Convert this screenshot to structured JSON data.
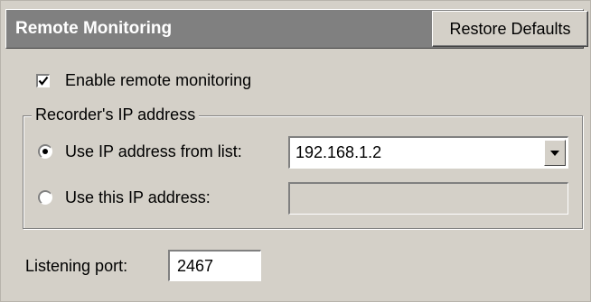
{
  "header": {
    "title": "Remote Monitoring",
    "restore_label": "Restore Defaults"
  },
  "enable_remote": {
    "label": "Enable remote monitoring",
    "checked": true
  },
  "ip_group": {
    "legend": "Recorder's IP address",
    "option_list": {
      "label": "Use IP address from list:",
      "selected": true,
      "value": "192.168.1.2"
    },
    "option_custom": {
      "label": "Use this IP address:",
      "selected": false,
      "value": ""
    }
  },
  "listening_port": {
    "label": "Listening port:",
    "value": "2467"
  },
  "icons": {
    "checkbox_check": "check-icon",
    "dropdown": "chevron-down-icon"
  }
}
